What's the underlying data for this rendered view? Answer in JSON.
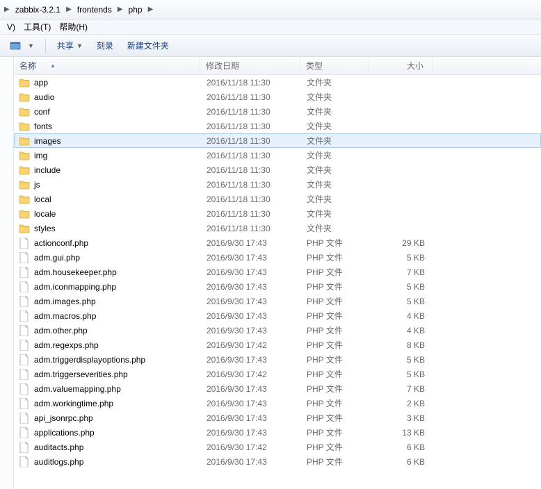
{
  "breadcrumb": [
    "zabbix-3.2.1",
    "frontends",
    "php"
  ],
  "menubar": {
    "view": "V)",
    "tools": "工具(T)",
    "help": "帮助(H)"
  },
  "toolbar": {
    "share": "共享",
    "burn": "刻录",
    "newfolder": "新建文件夹"
  },
  "columns": {
    "name": "名称",
    "date": "修改日期",
    "type": "类型",
    "size": "大小"
  },
  "types": {
    "folder": "文件夹",
    "php": "PHP 文件"
  },
  "files": [
    {
      "name": "app",
      "date": "2016/11/18 11:30",
      "kind": "folder",
      "size": ""
    },
    {
      "name": "audio",
      "date": "2016/11/18 11:30",
      "kind": "folder",
      "size": ""
    },
    {
      "name": "conf",
      "date": "2016/11/18 11:30",
      "kind": "folder",
      "size": ""
    },
    {
      "name": "fonts",
      "date": "2016/11/18 11:30",
      "kind": "folder",
      "size": ""
    },
    {
      "name": "images",
      "date": "2016/11/18 11:30",
      "kind": "folder",
      "size": "",
      "selected": true
    },
    {
      "name": "img",
      "date": "2016/11/18 11:30",
      "kind": "folder",
      "size": ""
    },
    {
      "name": "include",
      "date": "2016/11/18 11:30",
      "kind": "folder",
      "size": ""
    },
    {
      "name": "js",
      "date": "2016/11/18 11:30",
      "kind": "folder",
      "size": ""
    },
    {
      "name": "local",
      "date": "2016/11/18 11:30",
      "kind": "folder",
      "size": ""
    },
    {
      "name": "locale",
      "date": "2016/11/18 11:30",
      "kind": "folder",
      "size": ""
    },
    {
      "name": "styles",
      "date": "2016/11/18 11:30",
      "kind": "folder",
      "size": ""
    },
    {
      "name": "actionconf.php",
      "date": "2016/9/30 17:43",
      "kind": "php",
      "size": "29 KB"
    },
    {
      "name": "adm.gui.php",
      "date": "2016/9/30 17:43",
      "kind": "php",
      "size": "5 KB"
    },
    {
      "name": "adm.housekeeper.php",
      "date": "2016/9/30 17:43",
      "kind": "php",
      "size": "7 KB"
    },
    {
      "name": "adm.iconmapping.php",
      "date": "2016/9/30 17:43",
      "kind": "php",
      "size": "5 KB"
    },
    {
      "name": "adm.images.php",
      "date": "2016/9/30 17:43",
      "kind": "php",
      "size": "5 KB"
    },
    {
      "name": "adm.macros.php",
      "date": "2016/9/30 17:43",
      "kind": "php",
      "size": "4 KB"
    },
    {
      "name": "adm.other.php",
      "date": "2016/9/30 17:43",
      "kind": "php",
      "size": "4 KB"
    },
    {
      "name": "adm.regexps.php",
      "date": "2016/9/30 17:42",
      "kind": "php",
      "size": "8 KB"
    },
    {
      "name": "adm.triggerdisplayoptions.php",
      "date": "2016/9/30 17:43",
      "kind": "php",
      "size": "5 KB"
    },
    {
      "name": "adm.triggerseverities.php",
      "date": "2016/9/30 17:42",
      "kind": "php",
      "size": "5 KB"
    },
    {
      "name": "adm.valuemapping.php",
      "date": "2016/9/30 17:43",
      "kind": "php",
      "size": "7 KB"
    },
    {
      "name": "adm.workingtime.php",
      "date": "2016/9/30 17:43",
      "kind": "php",
      "size": "2 KB"
    },
    {
      "name": "api_jsonrpc.php",
      "date": "2016/9/30 17:43",
      "kind": "php",
      "size": "3 KB"
    },
    {
      "name": "applications.php",
      "date": "2016/9/30 17:43",
      "kind": "php",
      "size": "13 KB"
    },
    {
      "name": "auditacts.php",
      "date": "2016/9/30 17:42",
      "kind": "php",
      "size": "6 KB"
    },
    {
      "name": "auditlogs.php",
      "date": "2016/9/30 17:43",
      "kind": "php",
      "size": "6 KB"
    }
  ]
}
